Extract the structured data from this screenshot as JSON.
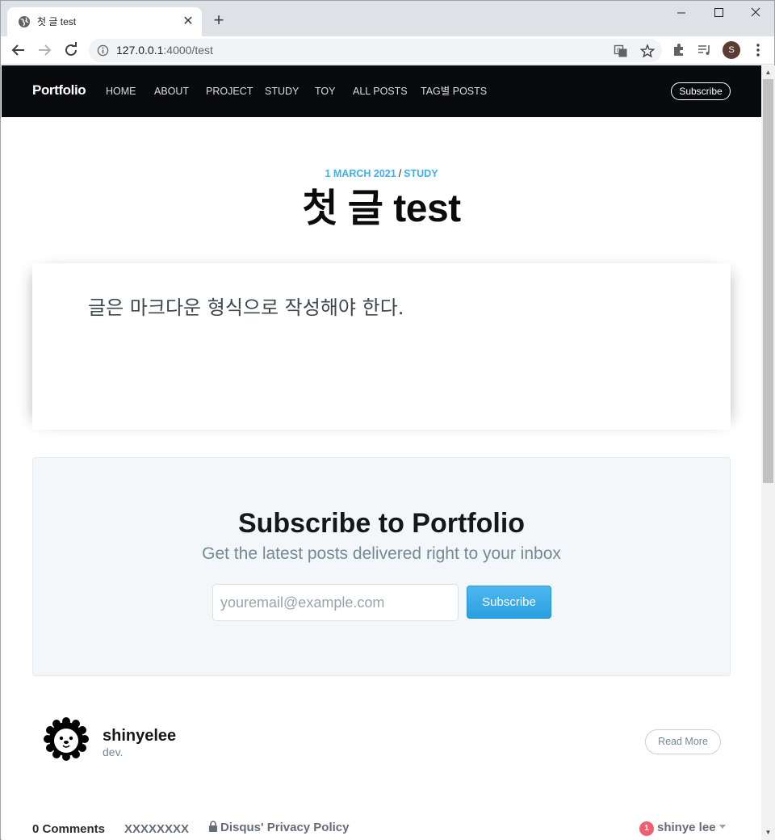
{
  "browser": {
    "tab_title": "첫 글 test",
    "new_tab_symbol": "+",
    "url_host": "127.0.0.1",
    "url_rest": ":4000/test",
    "profile_initial": "S"
  },
  "site": {
    "logo": "Portfolio",
    "nav": [
      "HOME",
      "ABOUT",
      "PROJECT",
      "STUDY",
      "TOY",
      "ALL POSTS",
      "TAG별 POSTS"
    ],
    "subscribe_label": "Subscribe"
  },
  "post": {
    "date": "1 MARCH 2021",
    "separator": "/",
    "tag": "STUDY",
    "title": "첫 글 test",
    "body": "글은 마크다운 형식으로 작성해야 한다."
  },
  "subscribe_form": {
    "title": "Subscribe to Portfolio",
    "description": "Get the latest posts delivered right to your inbox",
    "email_placeholder": "youremail@example.com",
    "button_label": "Subscribe"
  },
  "author": {
    "name": "shinyelee",
    "bio": "dev.",
    "read_more_label": "Read More"
  },
  "disqus": {
    "comment_count": "0 Comments",
    "site_name": "XXXXXXXX",
    "privacy_label": "Disqus' Privacy Policy",
    "notification_count": "1",
    "user_name": "shinye lee"
  },
  "colors": {
    "accent": "#3eb0ef",
    "nav_background": "#090a0b",
    "subscribe_background": "#f4f7fa",
    "notification_badge": "#f05f70"
  }
}
